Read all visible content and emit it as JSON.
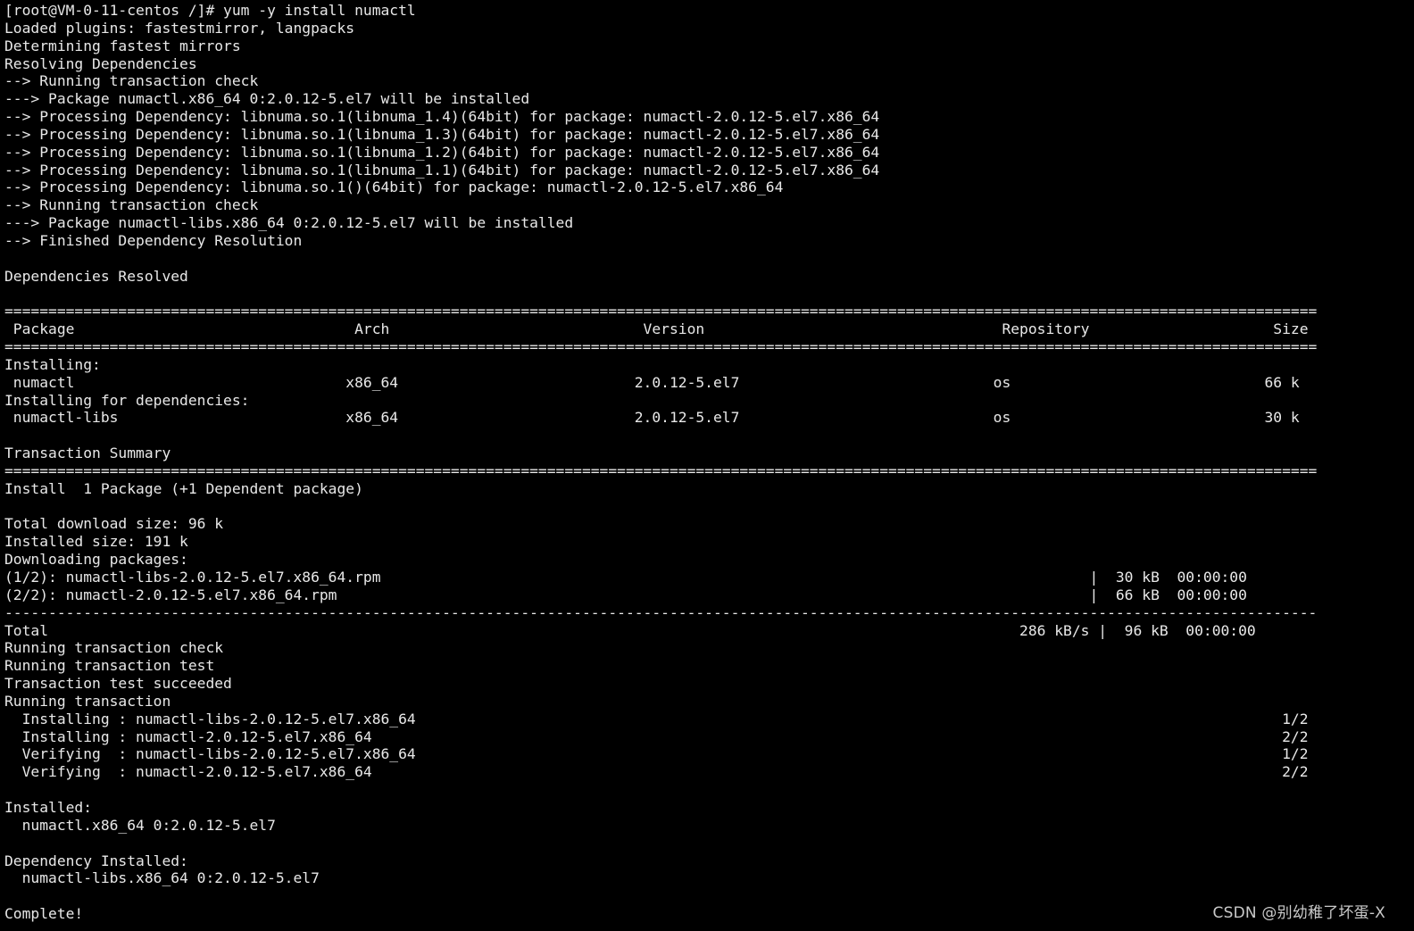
{
  "terminal": {
    "lines": [
      "[root@VM-0-11-centos /]# yum -y install numactl",
      "Loaded plugins: fastestmirror, langpacks",
      "Determining fastest mirrors",
      "Resolving Dependencies",
      "--> Running transaction check",
      "---> Package numactl.x86_64 0:2.0.12-5.el7 will be installed",
      "--> Processing Dependency: libnuma.so.1(libnuma_1.4)(64bit) for package: numactl-2.0.12-5.el7.x86_64",
      "--> Processing Dependency: libnuma.so.1(libnuma_1.3)(64bit) for package: numactl-2.0.12-5.el7.x86_64",
      "--> Processing Dependency: libnuma.so.1(libnuma_1.2)(64bit) for package: numactl-2.0.12-5.el7.x86_64",
      "--> Processing Dependency: libnuma.so.1(libnuma_1.1)(64bit) for package: numactl-2.0.12-5.el7.x86_64",
      "--> Processing Dependency: libnuma.so.1()(64bit) for package: numactl-2.0.12-5.el7.x86_64",
      "--> Running transaction check",
      "---> Package numactl-libs.x86_64 0:2.0.12-5.el7 will be installed",
      "--> Finished Dependency Resolution",
      "",
      "Dependencies Resolved",
      "",
      "======================================================================================================================================================",
      " Package                                Arch                             Version                                  Repository                     Size",
      "======================================================================================================================================================",
      "Installing:",
      " numactl                               x86_64                           2.0.12-5.el7                             os                             66 k",
      "Installing for dependencies:",
      " numactl-libs                          x86_64                           2.0.12-5.el7                             os                             30 k",
      "",
      "Transaction Summary",
      "======================================================================================================================================================",
      "Install  1 Package (+1 Dependent package)",
      "",
      "Total download size: 96 k",
      "Installed size: 191 k",
      "Downloading packages:",
      "(1/2): numactl-libs-2.0.12-5.el7.x86_64.rpm                                                                                 |  30 kB  00:00:00",
      "(2/2): numactl-2.0.12-5.el7.x86_64.rpm                                                                                      |  66 kB  00:00:00",
      "------------------------------------------------------------------------------------------------------------------------------------------------------",
      "Total                                                                                                               286 kB/s |  96 kB  00:00:00",
      "Running transaction check",
      "Running transaction test",
      "Transaction test succeeded",
      "Running transaction",
      "  Installing : numactl-libs-2.0.12-5.el7.x86_64                                                                                                   1/2",
      "  Installing : numactl-2.0.12-5.el7.x86_64                                                                                                        2/2",
      "  Verifying  : numactl-libs-2.0.12-5.el7.x86_64                                                                                                   1/2",
      "  Verifying  : numactl-2.0.12-5.el7.x86_64                                                                                                        2/2",
      "",
      "Installed:",
      "  numactl.x86_64 0:2.0.12-5.el7",
      "",
      "Dependency Installed:",
      "  numactl-libs.x86_64 0:2.0.12-5.el7",
      "",
      "Complete!"
    ],
    "watermark": "CSDN @别幼稚了坏蛋-X",
    "colors": {
      "background": "#000000",
      "foreground": "#e8e8e8"
    }
  }
}
